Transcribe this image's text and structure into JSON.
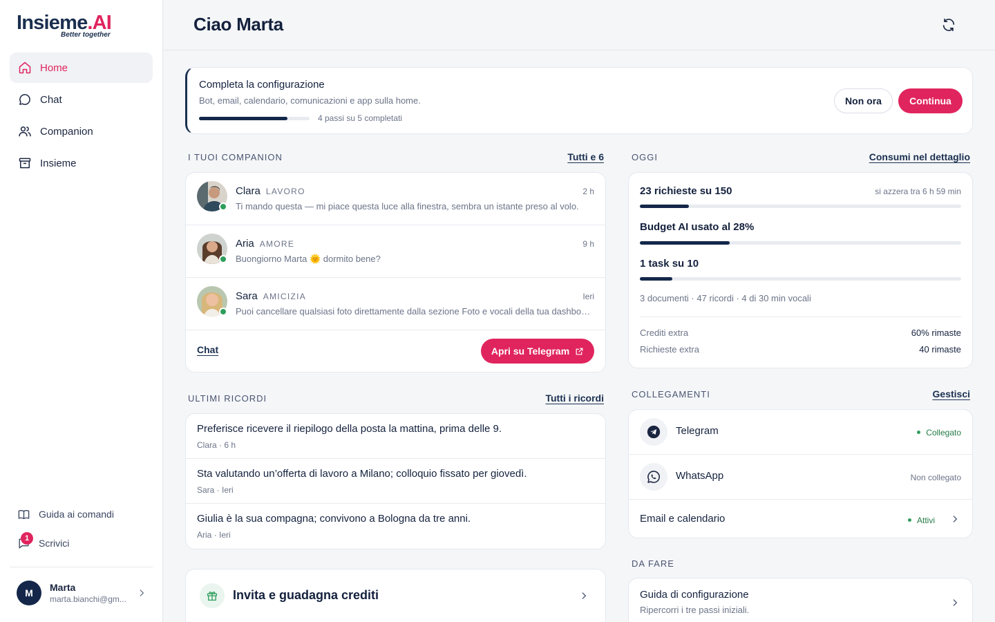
{
  "brand": {
    "name_part1": "Insieme",
    "name_part2": ".AI",
    "tagline": "Better together"
  },
  "sidebar": {
    "items": [
      {
        "label": "Home",
        "icon": "home-icon",
        "active": true
      },
      {
        "label": "Chat",
        "icon": "chat-bubble-icon"
      },
      {
        "label": "Companion",
        "icon": "users-icon"
      },
      {
        "label": "Insieme",
        "icon": "archive-icon"
      }
    ],
    "footer_links": [
      {
        "label": "Guida ai comandi",
        "icon": "book-icon"
      },
      {
        "label": "Scrivici",
        "icon": "message-icon",
        "badge": "1"
      }
    ],
    "user": {
      "initial": "M",
      "name": "Marta",
      "email": "marta.bianchi@gm..."
    }
  },
  "header": {
    "greeting": "Ciao Marta",
    "refresh_icon": "refresh-icon"
  },
  "setup": {
    "title": "Completa la configurazione",
    "subtitle": "Bot, email, calendario, comunicazioni e app sulla home.",
    "progress_fraction": 0.8,
    "steps_text": "4 passi su 5 completati",
    "dismiss_label": "Non ora",
    "continue_label": "Continua"
  },
  "companions": {
    "title": "I tuoi companion",
    "link": "Tutti e 6",
    "items": [
      {
        "name": "Clara",
        "tag": "Lavoro",
        "time": "2 h",
        "message": "Ti mando questa — mi piace questa luce alla finestra, sembra un istante preso al volo."
      },
      {
        "name": "Aria",
        "tag": "Amore",
        "time": "9 h",
        "message": "Buongiorno Marta 🌞 dormito bene?"
      },
      {
        "name": "Sara",
        "tag": "Amicizia",
        "time": "Ieri",
        "message": "Puoi cancellare qualsiasi foto direttamente dalla sezione Foto e vocali della tua dashboard."
      }
    ],
    "chat_link": "Chat",
    "telegram_button": "Apri su Telegram"
  },
  "memories": {
    "title": "Ultimi ricordi",
    "link": "Tutti i ricordi",
    "items": [
      {
        "text": "Preferisce ricevere il riepilogo della posta la mattina, prima delle 9.",
        "meta": "Clara · 6 h"
      },
      {
        "text": "Sta valutando un’offerta di lavoro a Milano; colloquio fissato per giovedì.",
        "meta": "Sara · Ieri"
      },
      {
        "text": "Giulia è la sua compagna; convivono a Bologna da tre anni.",
        "meta": "Aria · Ieri"
      }
    ]
  },
  "invite": {
    "label": "Invita e guadagna crediti",
    "icon": "gift-icon"
  },
  "today": {
    "title": "Oggi",
    "link": "Consumi nel dettaglio",
    "requests": {
      "label": "23 richieste su 150",
      "reset": "si azzera tra 6 h 59 min",
      "fraction": 0.153
    },
    "budget": {
      "label": "Budget AI usato al 28%",
      "fraction": 0.28
    },
    "tasks": {
      "label": "1 task su 10",
      "fraction": 0.1
    },
    "docs_line": "3 documenti · 47 ricordi · 4 di 30 min vocali",
    "extras": [
      {
        "label": "Crediti extra",
        "value": "60% rimaste"
      },
      {
        "label": "Richieste extra",
        "value": "40 rimaste"
      }
    ]
  },
  "connections": {
    "title": "Collegamenti",
    "link": "Gestisci",
    "items": [
      {
        "name": "Telegram",
        "status": "Collegato",
        "connected": true,
        "icon": "telegram-icon"
      },
      {
        "name": "WhatsApp",
        "status": "Non collegato",
        "connected": false,
        "icon": "whatsapp-icon"
      },
      {
        "name": "Email e calendario",
        "status": "Attivi",
        "connected": true
      }
    ]
  },
  "todo": {
    "title": "Da fare",
    "items": [
      {
        "title": "Guida di configurazione",
        "subtitle": "Ripercorri i tre passi iniziali."
      }
    ]
  },
  "colors": {
    "accent": "#e0245e",
    "navy": "#14274a",
    "success": "#2e9e5b"
  }
}
